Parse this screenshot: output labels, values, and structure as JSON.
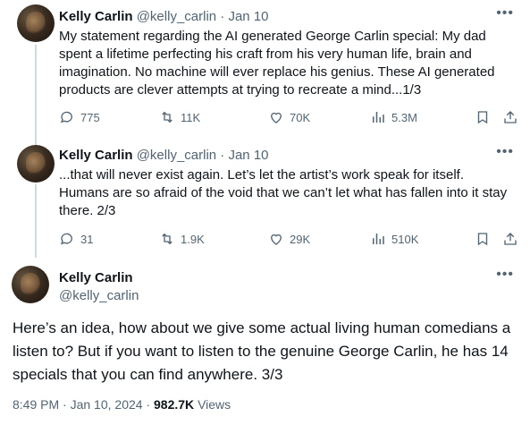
{
  "tweets": [
    {
      "name": "Kelly Carlin",
      "handle": "@kelly_carlin",
      "sep": "·",
      "date": "Jan 10",
      "text": "My statement regarding the AI generated George Carlin special: My dad spent a lifetime perfecting his craft from his very human life, brain and imagination.  No machine will ever replace his genius. These AI generated products are clever attempts at trying to recreate a mind...1/3",
      "replies": "775",
      "retweets": "11K",
      "likes": "70K",
      "views": "5.3M"
    },
    {
      "name": "Kelly Carlin",
      "handle": "@kelly_carlin",
      "sep": "·",
      "date": "Jan 10",
      "text": "...that will never exist again. Let’s let the artist’s work speak for itself. Humans are so afraid of the void that we can’t let what has fallen into it stay there. 2/3",
      "replies": "31",
      "retweets": "1.9K",
      "likes": "29K",
      "views": "510K"
    }
  ],
  "main": {
    "name": "Kelly Carlin",
    "handle": "@kelly_carlin",
    "text": "Here’s an idea, how about we give some actual living human comedians a listen to? But if you want to listen to the genuine George Carlin, he has 14 specials that you can find anywhere. 3/3",
    "time": "8:49 PM",
    "date": "Jan 10, 2024",
    "views_count": "982.7K",
    "views_label": "Views"
  },
  "icons": {
    "more": "more-icon",
    "reply": "reply-icon",
    "retweet": "retweet-icon",
    "like": "like-icon",
    "views": "views-icon",
    "bookmark": "bookmark-icon",
    "share": "share-icon"
  },
  "colors": {
    "text": "#0f1419",
    "secondary": "#536471",
    "line": "#cfd9de"
  }
}
